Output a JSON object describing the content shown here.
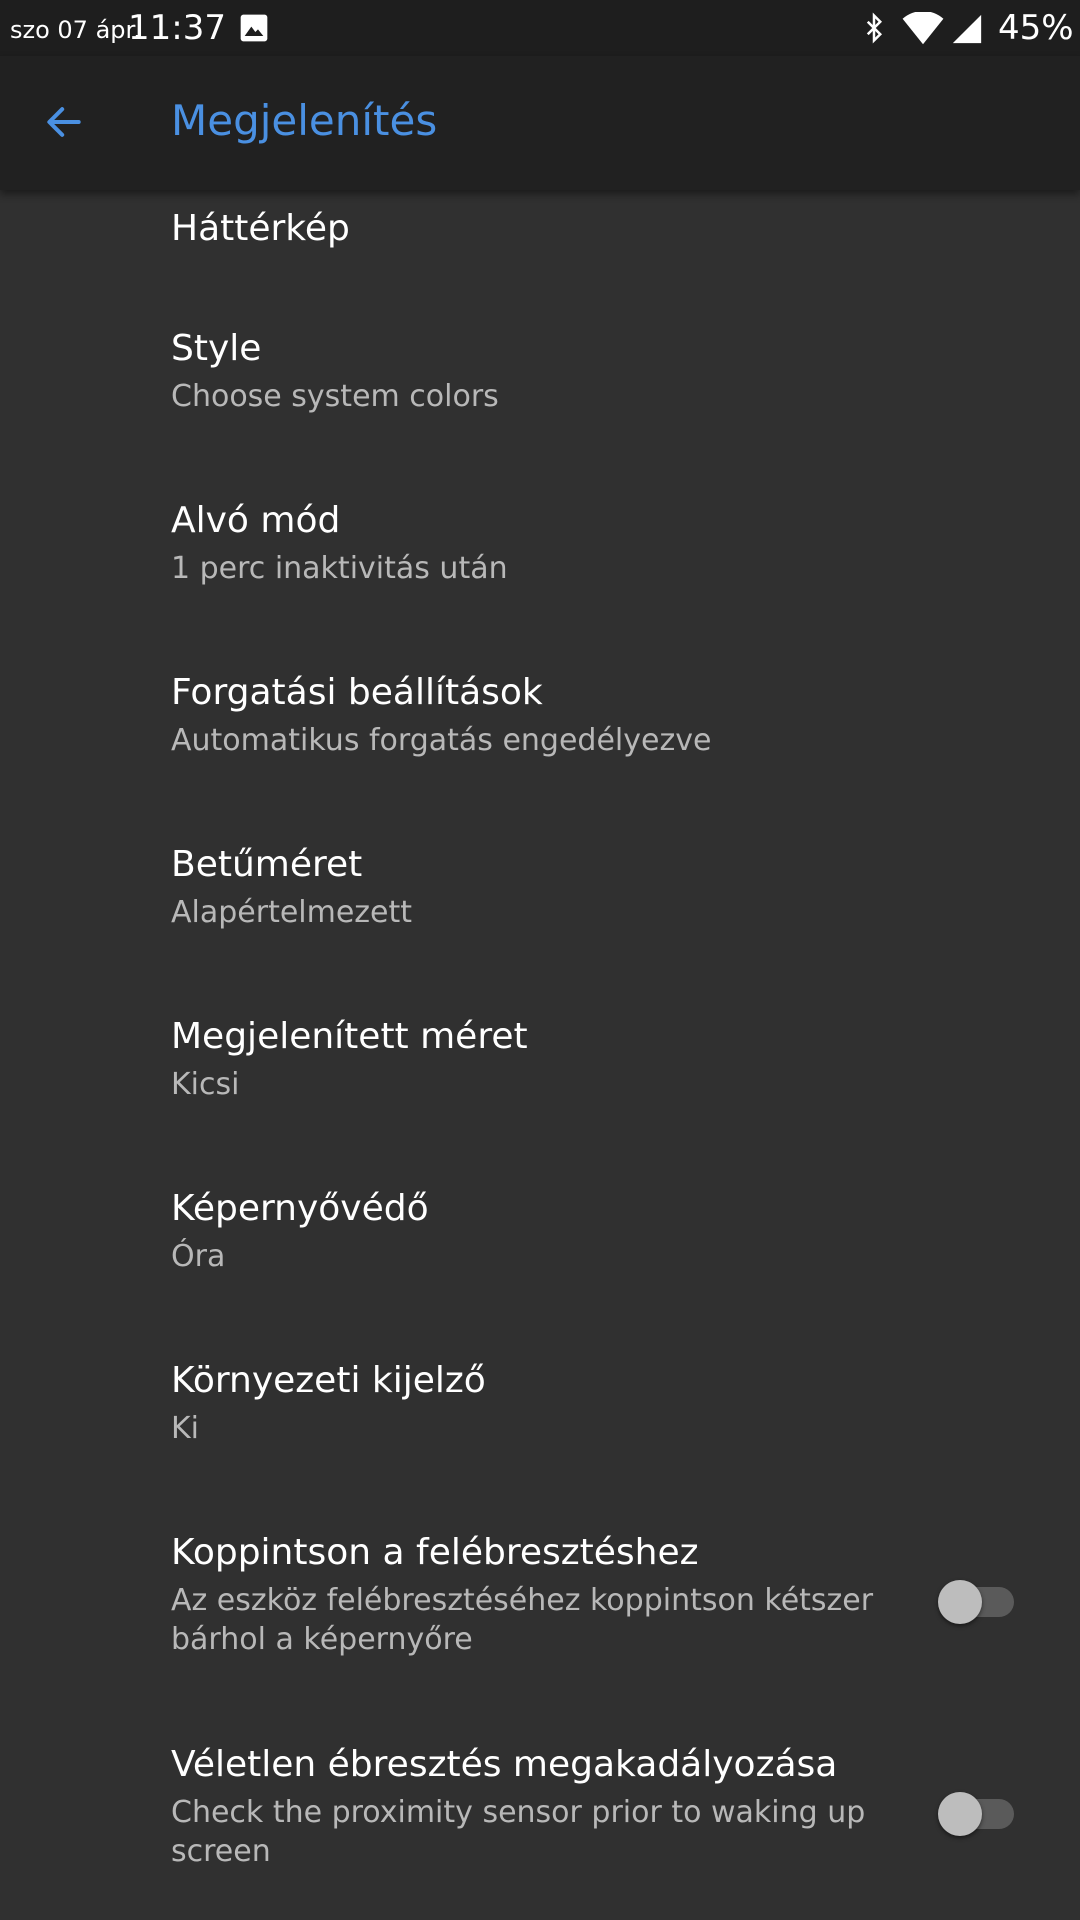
{
  "status_bar": {
    "date": "szo 07 ápr.",
    "time": "11:37",
    "battery": "45%",
    "icons": [
      "image-icon",
      "bluetooth-icon",
      "wifi-icon",
      "signal-icon"
    ]
  },
  "app_bar": {
    "title": "Megjelenítés",
    "back_icon": "arrow-back-icon",
    "accent_color": "#4a90e2"
  },
  "settings": [
    {
      "title": "Háttérkép",
      "subtitle": ""
    },
    {
      "title": "Style",
      "subtitle": "Choose system colors"
    },
    {
      "title": "Alvó mód",
      "subtitle": "1 perc inaktivitás után"
    },
    {
      "title": "Forgatási beállítások",
      "subtitle": "Automatikus forgatás engedélyezve"
    },
    {
      "title": "Betűméret",
      "subtitle": "Alapértelmezett"
    },
    {
      "title": "Megjelenített méret",
      "subtitle": "Kicsi"
    },
    {
      "title": "Képernyővédő",
      "subtitle": "Óra"
    },
    {
      "title": "Környezeti kijelző",
      "subtitle": "Ki"
    },
    {
      "title": "Koppintson a felébresztéshez",
      "subtitle": "Az eszköz felébresztéséhez koppintson kétszer bárhol a képernyőre",
      "toggle": false
    },
    {
      "title": "Véletlen ébresztés megakadályozása",
      "subtitle": "Check the proximity sensor prior to waking up screen",
      "toggle": false
    }
  ]
}
